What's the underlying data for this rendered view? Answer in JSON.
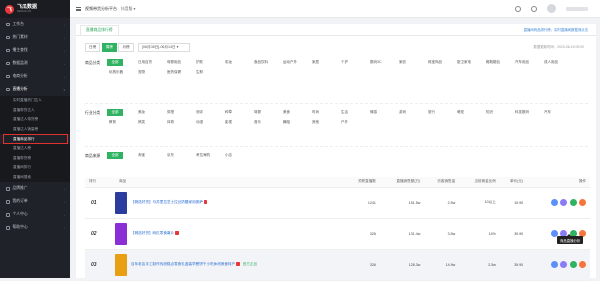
{
  "app": {
    "logo_name": "飞瓜数据",
    "logo_sub": "FEIGUA.CN",
    "logo_mark": "飞"
  },
  "topbar": {
    "product": "视频带货分析平台",
    "switch": "抖音版",
    "switch_caret": "▾"
  },
  "sidebar": {
    "items": [
      {
        "label": "工作台",
        "open": false
      },
      {
        "label": "热门素材",
        "open": false
      },
      {
        "label": "播主查找",
        "open": false
      },
      {
        "label": "数据监测",
        "open": false
      },
      {
        "label": "电商分析",
        "open": false
      },
      {
        "label": "直播分析",
        "open": true
      }
    ],
    "sub_items": [
      {
        "label": "实时直播热门达人",
        "active": false,
        "highlight": false
      },
      {
        "label": "直播带货达人",
        "active": false,
        "highlight": false
      },
      {
        "label": "直播达人带货榜",
        "active": false,
        "highlight": false
      },
      {
        "label": "直播达人销量榜",
        "active": false,
        "highlight": false
      },
      {
        "label": "直播商品排行",
        "active": true,
        "highlight": true
      },
      {
        "label": "直播达人榜",
        "active": false,
        "highlight": false
      },
      {
        "label": "直播带货榜",
        "active": false,
        "highlight": false
      },
      {
        "label": "直播间排行",
        "active": false,
        "highlight": false
      },
      {
        "label": "直播间搜索",
        "active": false,
        "highlight": false
      }
    ],
    "bottom": [
      {
        "label": "品牌推广"
      },
      {
        "label": "我的订单"
      },
      {
        "label": "个人中心"
      },
      {
        "label": "帮助中心"
      }
    ]
  },
  "main": {
    "tab": "直播商品排行榜",
    "notice": "直播间商品排行榜，实时直播间数据请点击",
    "updated": "数据更新时间：2020-06-15 09:00",
    "date_buttons": [
      {
        "label": "日榜",
        "on": false
      },
      {
        "label": "周榜",
        "on": true
      },
      {
        "label": "月榜",
        "on": false
      }
    ],
    "date_value": "[06月08日]-06月14日 ▾",
    "filters": [
      {
        "label": "商品分类",
        "chips": [
          "全部",
          "日用百货",
          "母婴用品",
          "护肤",
          "彩妆",
          "食品饮料",
          "运动户外",
          "家居",
          "个护",
          "数码3C",
          "家纺",
          "珠宝饰品",
          "厨卫家电",
          "鞋靴箱包",
          "汽车用品",
          "成人用品",
          "玩具乐器",
          "宠物",
          "医药保健",
          "生鲜"
        ]
      },
      {
        "label": "行业分类",
        "chips": [
          "全部",
          "美妆",
          "穿搭",
          "测评",
          "种草",
          "母婴",
          "美食",
          "时尚",
          "生活",
          "情感",
          "游戏",
          "旅行",
          "萌宠",
          "知识",
          "科技数码",
          "汽车",
          "教育",
          "搞笑",
          "体育",
          "动漫",
          "影视",
          "音乐",
          "舞蹈",
          "其他",
          "户外"
        ]
      },
      {
        "label": "商品来源",
        "chips": [
          "全部",
          "淘宝",
          "京东",
          "考拉海购",
          "小店"
        ]
      }
    ],
    "table": {
      "headers": [
        "排行",
        "商品",
        "关联直播数",
        "直播销售额(万)",
        "访客销售量",
        "当前佣金比例",
        "单价(元)",
        "操作"
      ],
      "rows": [
        {
          "rank": "01",
          "name": "【精选好货】马苏里拉芝士拉丝奶酪家用披萨",
          "tag": "",
          "cols": [
            "1241",
            "151.5w",
            "2.5w",
            "10以上",
            "19.90"
          ],
          "hl": false,
          "thumb": "#2a3c9e"
        },
        {
          "rank": "02",
          "name": "【精选好货】网红零食薯片",
          "tag": "",
          "cols": [
            "326",
            "131.4w",
            "3.5w",
            "14%",
            "39.90"
          ],
          "hl": false,
          "thumb": "#8a2ed6"
        },
        {
          "rank": "03",
          "name": "百年老店手工制作传统糕点零食礼盒装早餐饼干小吃休闲美食特产",
          "tag": "官方正品",
          "cols": [
            "326",
            "128.3w",
            "14.9w",
            "2.5w",
            "39.90"
          ],
          "hl": true,
          "thumb": "#e8a012"
        }
      ]
    },
    "tooltip": "商品直播分析"
  },
  "ops_colors": [
    "#5b8ff9",
    "#8b7cf6",
    "#2fb261",
    "#f5753b"
  ]
}
